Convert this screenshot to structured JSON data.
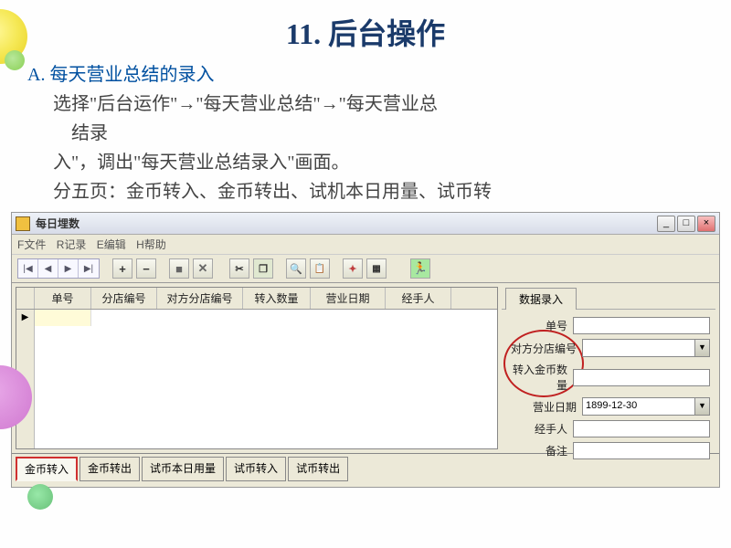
{
  "title": "11. 后台操作",
  "section": {
    "a_label": "A. 每天营业总结的录入",
    "line1a": "选择\"后台运作\"→\"每天营业总结\"→\"每天营业总",
    "line1b": "结录",
    "line2": "入\"，调出\"每天营业总结录入\"画面。",
    "line3": "分五页：金币转入、金币转出、试机本日用量、试币转"
  },
  "window": {
    "title": "每日埋数",
    "menu": {
      "file": "F文件",
      "record": "R记录",
      "edit": "E编辑",
      "help": "H帮助"
    },
    "winbtns": {
      "min": "_",
      "max": "□",
      "close": "×"
    },
    "grid": {
      "headers": [
        "",
        "单号",
        "分店编号",
        "对方分店编号",
        "转入数量",
        "营业日期",
        "经手人"
      ],
      "rowmark": "▶"
    },
    "side": {
      "tab": "数据录入",
      "fields": {
        "f1": "单号",
        "f2": "对方分店编号",
        "f3": "转入金币数量",
        "f4": "营业日期",
        "f4_value": "1899-12-30",
        "f5": "经手人",
        "f6": "备注"
      }
    },
    "tabs": [
      "金币转入",
      "金币转出",
      "试币本日用量",
      "试币转入",
      "试币转出"
    ]
  }
}
